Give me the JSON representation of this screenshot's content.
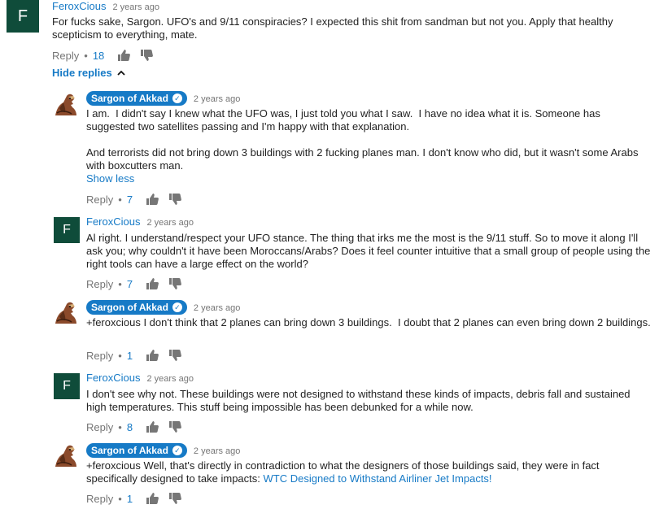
{
  "colors": {
    "accent": "#167ac6",
    "avatar_green": "#0f4c3a",
    "meta": "#767676"
  },
  "top_comment": {
    "author": "FeroxCious",
    "avatar_letter": "F",
    "time": "2 years ago",
    "text": "For fucks sake, Sargon. UFO's and 9/11 conspiracies? I expected this shit from sandman but not you. Apply that healthy scepticism to everything, mate.",
    "reply_label": "Reply",
    "dot": "•",
    "likes": "18"
  },
  "hide_replies": "Hide replies",
  "replies": [
    {
      "author": "Sargon of Akkad",
      "time": "2 years ago",
      "text": "I am.  I didn't say I knew what the UFO was, I just told you what I saw.  I have no idea what it is. Someone has suggested two satellites passing and I'm happy with that explanation.\n\nAnd terrorists did not bring down 3 buildings with 2 fucking planes man. I don't know who did, but it wasn't some Arabs with boxcutters man.",
      "show_less": "Show less",
      "reply_label": "Reply",
      "likes": "7"
    },
    {
      "author": "FeroxCious",
      "avatar_letter": "F",
      "time": "2 years ago",
      "text": "Al right. I understand/respect your UFO stance. The thing that irks me the most is the 9/11 stuff. So to move it along I'll ask you; why couldn't it have been Moroccans/Arabs? Does it feel counter intuitive that a small group of people using the right tools can have a large effect on the world?",
      "reply_label": "Reply",
      "likes": "7"
    },
    {
      "author": "Sargon of Akkad",
      "time": "2 years ago",
      "text": "+feroxcious I don't think that 2 planes can bring down 3 buildings.  I doubt that 2 planes can even bring down 2 buildings.",
      "reply_label": "Reply",
      "likes": "1"
    },
    {
      "author": "FeroxCious",
      "avatar_letter": "F",
      "time": "2 years ago",
      "text": "I don't see why not. These buildings were not designed to withstand these kinds of impacts, debris fall and sustained high temperatures. This stuff being impossible has been debunked for a while now.",
      "reply_label": "Reply",
      "likes": "8"
    },
    {
      "author": "Sargon of Akkad",
      "time": "2 years ago",
      "text": "+feroxcious Well, that's directly in contradiction to what the designers of those buildings said, they were in fact specifically designed to take impacts: ",
      "link": "WTC Designed to Withstand Airliner Jet Impacts!",
      "reply_label": "Reply",
      "likes": "1"
    }
  ],
  "icons": {
    "like": "thumbs-up-icon",
    "dislike": "thumbs-down-icon",
    "more": "kebab-menu-icon",
    "collapse": "chevron-up-icon",
    "verified": "checkmark-icon"
  }
}
